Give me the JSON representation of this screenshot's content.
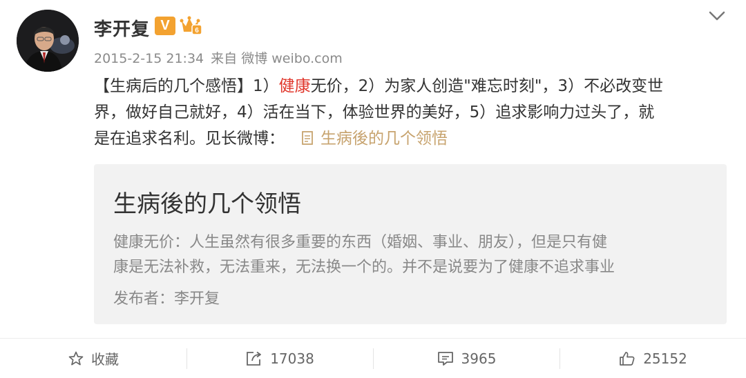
{
  "post": {
    "author": "李开复",
    "verified_badge": "V",
    "timestamp": "2015-2-15 21:34",
    "source": "来自 微博 weibo.com",
    "content_lines": [
      {
        "pre": "【生病后的几个感悟】1）",
        "highlight": "健康",
        "post": "无价，2）为家人创造\"难忘时刻\"，3）不必改变世"
      },
      {
        "pre": "界，做好自己就好，4）活在当下，体验世界的美好，5）追求影响力过头了，就",
        "highlight": "",
        "post": ""
      },
      {
        "pre": "是在追求名利。见长微博：",
        "highlight": "",
        "post": ""
      }
    ],
    "link_text": "生病後的几个领悟",
    "accent_colors": {
      "highlight": "#e0362b",
      "link": "#c7a36e",
      "vip": "#f3a230"
    }
  },
  "card": {
    "title": "生病後的几个领悟",
    "body_lines": [
      "健康无价：人生虽然有很多重要的东西（婚姻、事业、朋友），但是只有健",
      "康是无法补救，无法重来，无法换一个的。并不是说要为了健康不追求事业"
    ],
    "author": "发布者：李开复"
  },
  "actions": [
    {
      "icon": "star-icon",
      "label": "收藏"
    },
    {
      "icon": "repost-icon",
      "label": "17038"
    },
    {
      "icon": "comment-icon",
      "label": "3965"
    },
    {
      "icon": "like-icon",
      "label": "25152"
    }
  ]
}
